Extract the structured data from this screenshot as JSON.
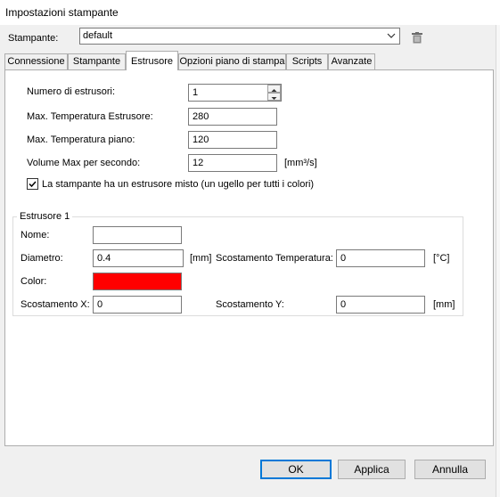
{
  "window": {
    "title": "Impostazioni stampante"
  },
  "printer": {
    "label": "Stampante:",
    "value": "default",
    "delete_icon": "trash-icon"
  },
  "tabs": [
    {
      "label": "Connessione"
    },
    {
      "label": "Stampante"
    },
    {
      "label": "Estrusore",
      "active": true
    },
    {
      "label": "Opzioni piano di stampa"
    },
    {
      "label": "Scripts"
    },
    {
      "label": "Avanzate"
    }
  ],
  "extruder_tab": {
    "num_extruders_label": "Numero di estrusori:",
    "num_extruders_value": "1",
    "max_extruder_temp_label": "Max. Temperatura Estrusore:",
    "max_extruder_temp_value": "280",
    "max_bed_temp_label": "Max. Temperatura piano:",
    "max_bed_temp_value": "120",
    "max_volume_label": "Volume Max per secondo:",
    "max_volume_value": "12",
    "max_volume_unit": "[mm³/s]",
    "mixing_checkbox_label": "La stampante ha un estrusore misto (un ugello per tutti i colori)",
    "mixing_checked": true
  },
  "extruder1": {
    "group_title": "Estrusore 1",
    "name_label": "Nome:",
    "name_value": "",
    "diameter_label": "Diametro:",
    "diameter_value": "0.4",
    "diameter_unit": "[mm]",
    "temp_offset_label": "Scostamento Temperatura:",
    "temp_offset_value": "0",
    "temp_offset_unit": "[°C]",
    "color_label": "Color:",
    "color_value": "#ff0000",
    "offset_x_label": "Scostamento X:",
    "offset_x_value": "0",
    "offset_y_label": "Scostamento Y:",
    "offset_y_value": "0",
    "offset_y_unit": "[mm]"
  },
  "buttons": {
    "ok": "OK",
    "apply": "Applica",
    "cancel": "Annulla"
  }
}
